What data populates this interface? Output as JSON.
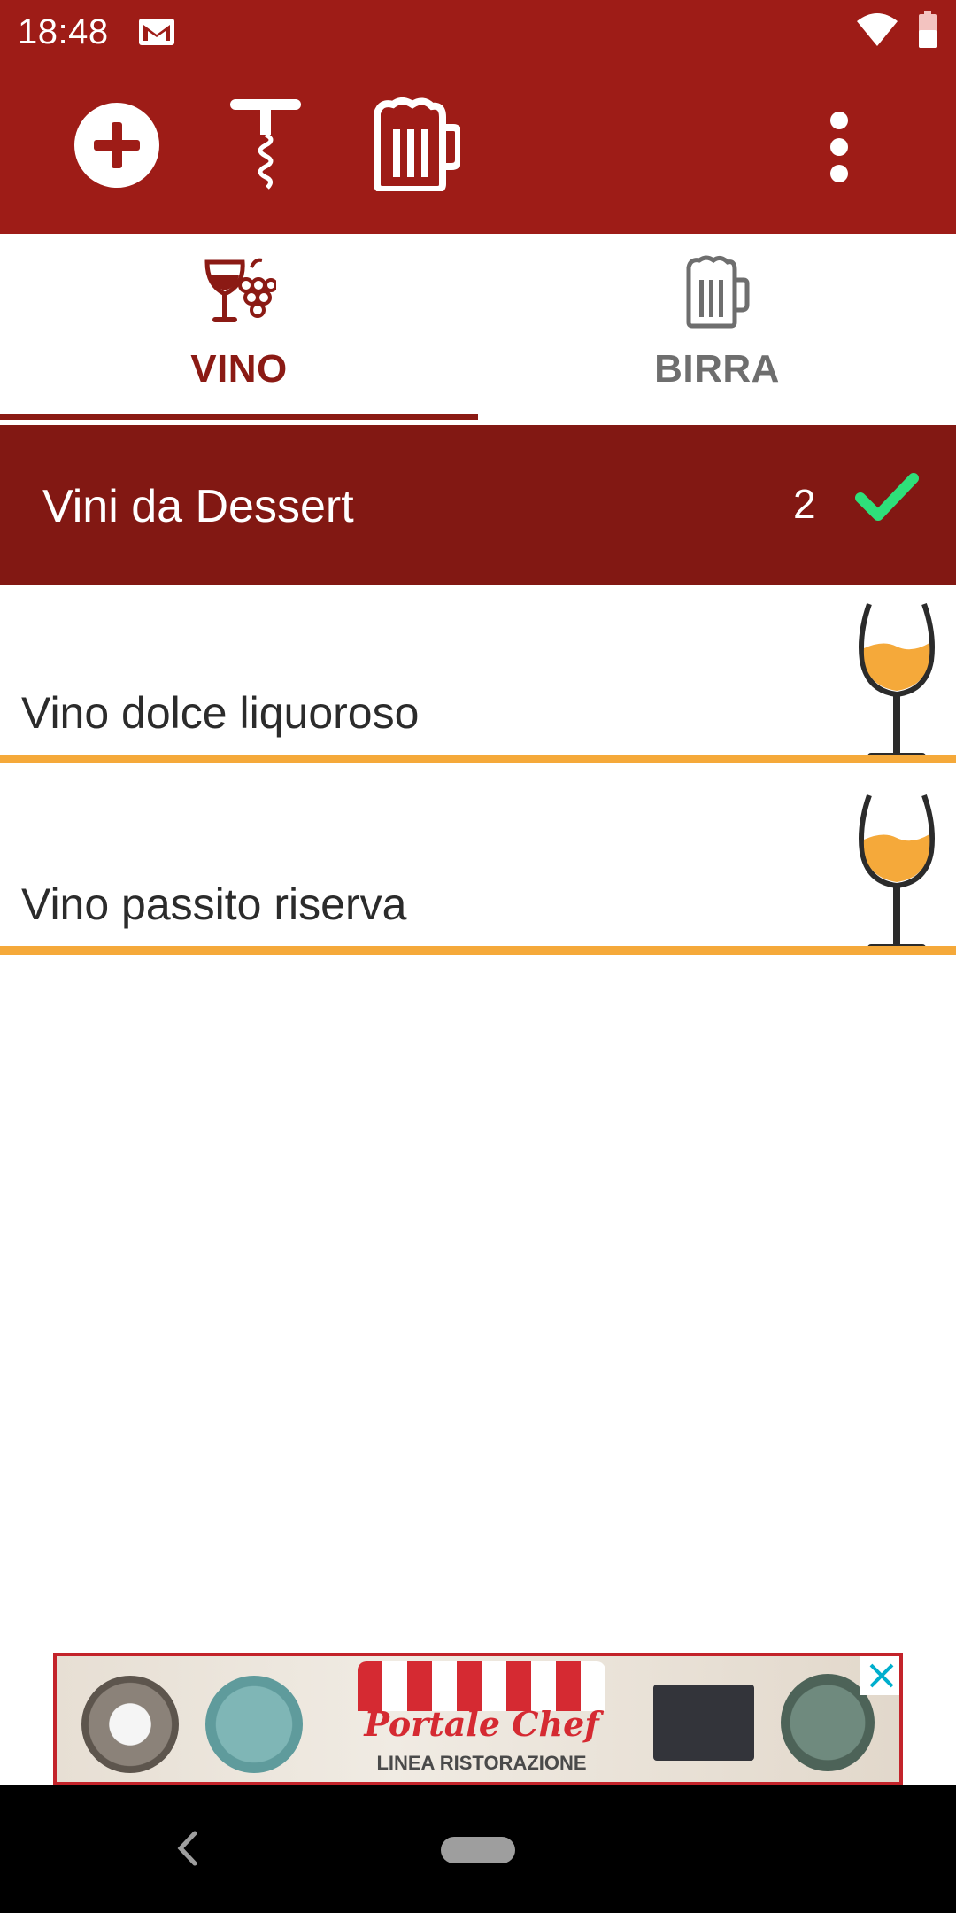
{
  "status_bar": {
    "time": "18:48",
    "icons": [
      "mail-icon",
      "wifi-icon",
      "battery-icon"
    ]
  },
  "toolbar": {
    "background": "#9e1c17",
    "actions": [
      "add-icon",
      "corkscrew-icon",
      "beer-mug-icon",
      "more-vert-icon"
    ]
  },
  "tabs": [
    {
      "label": "VINO",
      "icon": "wine-grapes-icon",
      "selected": true
    },
    {
      "label": "BIRRA",
      "icon": "beer-mug-icon",
      "selected": false
    }
  ],
  "category": {
    "title": "Vini da Dessert",
    "count": "2",
    "status_icon": "check-icon",
    "background": "#821813"
  },
  "wines": [
    {
      "name": "Vino dolce liquoroso",
      "icon": "dessert-wine-glass-icon"
    },
    {
      "name": "Vino passito riserva",
      "icon": "dessert-wine-glass-icon"
    }
  ],
  "ad": {
    "brand": "Portale Chef",
    "tagline": "LINEA RISTORAZIONE"
  },
  "colors": {
    "primary": "#9e1c17",
    "accent_line": "#f5a93a",
    "check": "#2ee07a"
  }
}
